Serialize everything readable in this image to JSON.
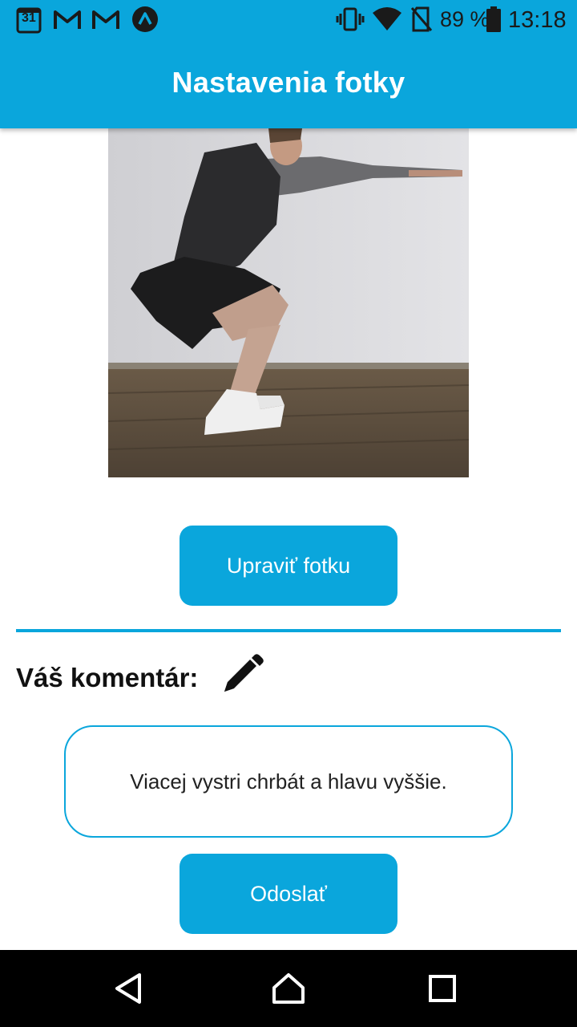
{
  "status_bar": {
    "calendar_day": "31",
    "battery_percent": "89 %",
    "time": "13:18",
    "icons": [
      "calendar-icon",
      "gmail-icon",
      "gmail-icon",
      "app-icon",
      "vibrate-icon",
      "wifi-icon",
      "no-sim-icon",
      "battery-icon"
    ]
  },
  "header": {
    "title": "Nastavenia fotky"
  },
  "photo": {
    "icon": "exercise-photo"
  },
  "edit_button": {
    "label": "Upraviť fotku"
  },
  "comment": {
    "label": "Váš komentár:",
    "icon": "pencil-icon",
    "text": "Viacej vystri chrbát a hlavu vyššie."
  },
  "send_button": {
    "label": "Odoslať"
  },
  "nav_bar": {
    "icons": [
      "back-icon",
      "home-icon",
      "recents-icon"
    ]
  },
  "colors": {
    "accent": "#0aa6dc",
    "nav_bar": "#000000"
  }
}
